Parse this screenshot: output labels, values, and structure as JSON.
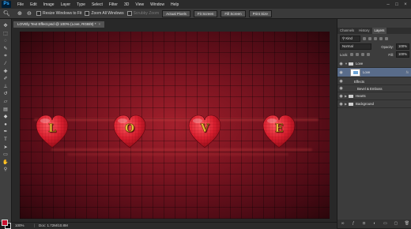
{
  "menu": {
    "logo": "Ps",
    "items": [
      "File",
      "Edit",
      "Image",
      "Layer",
      "Type",
      "Select",
      "Filter",
      "3D",
      "View",
      "Window",
      "Help"
    ]
  },
  "options": {
    "resize_windows": "Resize Windows to Fit",
    "zoom_all": "Zoom All Windows",
    "scrubby_zoom": "Scrubby Zoom",
    "actual_pixels": "Actual Pixels",
    "fit_screen": "Fit Screen",
    "fill_screen": "Fill Screen",
    "print_size": "Print Size"
  },
  "document": {
    "tab_title": "LOVEly Text Effect.psd @ 100% (Love, RGB/8) *",
    "letters": [
      "L",
      "O",
      "V",
      "E"
    ]
  },
  "status": {
    "zoom": "100%",
    "doc_info": "Doc: 1.72M/10.8M"
  },
  "panel": {
    "tabs": [
      "Channels",
      "History",
      "Layers"
    ],
    "active_tab": "Layers",
    "kind": "Kind",
    "blend_mode": "Normal",
    "opacity_label": "Opacity:",
    "opacity_value": "100%",
    "lock_label": "Lock:",
    "fill_label": "Fill:",
    "fill_value": "100%",
    "layers": [
      {
        "name": "Love"
      },
      {
        "name": "Love",
        "fx": "fx"
      },
      {
        "name": "Effects"
      },
      {
        "name": "Bevel & Emboss"
      },
      {
        "name": "Hearts"
      },
      {
        "name": "Background"
      }
    ]
  },
  "colors": {
    "foreground": "#c8102e",
    "background": "#111111",
    "heart_red": "#d81e2e",
    "letter_gold": "#e8bc3a",
    "selected_layer": "#596c8a"
  }
}
